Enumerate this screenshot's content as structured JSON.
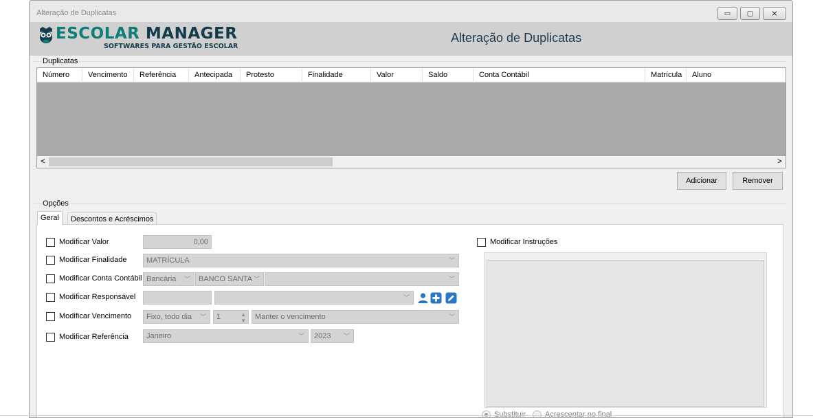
{
  "window": {
    "title": "Alteração de Duplicatas",
    "minimize_glyph": "▭",
    "maximize_glyph": "▢",
    "close_glyph": "✕"
  },
  "banner": {
    "logo_part1": "ESCOLAR",
    "logo_part2": "MANAGER",
    "logo_tagline": "SOFTWARES PARA GESTÃO ESCOLAR",
    "heading": "Alteração de Duplicatas",
    "colors": {
      "teal": "#0e7d76",
      "navy": "#133b4c"
    }
  },
  "duplicatas": {
    "group_label": "Duplicatas",
    "columns": [
      "Número",
      "Vencimento",
      "Referência",
      "Antecipada",
      "Protesto",
      "Finalidade",
      "Valor",
      "Saldo",
      "Conta Contábil",
      "Matrícula",
      "Aluno"
    ],
    "rows": [],
    "scroll_left": "<",
    "scroll_right": ">",
    "add_button": "Adicionar",
    "remove_button": "Remover"
  },
  "opcoes": {
    "group_label": "Opções",
    "tabs": [
      {
        "label": "Geral",
        "active": true
      },
      {
        "label": "Descontos e Acréscimos",
        "active": false
      }
    ],
    "geral": {
      "valor": {
        "label": "Modificar Valor",
        "checked": false,
        "value": "0,00"
      },
      "finalidade": {
        "label": "Modificar Finalidade",
        "checked": false,
        "value": "MATRÍCULA"
      },
      "conta": {
        "label": "Modificar Conta Contábil",
        "checked": false,
        "tipo": "Bancária",
        "banco": "BANCO SANTA",
        "conta": ""
      },
      "responsavel": {
        "label": "Modificar Responsável",
        "checked": false,
        "codigo": "",
        "nome": ""
      },
      "vencimento": {
        "label": "Modificar Vencimento",
        "checked": false,
        "modo": "Fixo, todo dia",
        "dia": "1",
        "acao": "Manter o vencimento"
      },
      "referencia": {
        "label": "Modificar Referência",
        "checked": false,
        "mes": "Janeiro",
        "ano": "2023"
      },
      "instrucoes": {
        "label": "Modificar Instruções",
        "checked": false,
        "text": "",
        "option_replace": "Substituir",
        "option_append": "Acrescentar no final",
        "selected": "Substituir"
      }
    }
  }
}
